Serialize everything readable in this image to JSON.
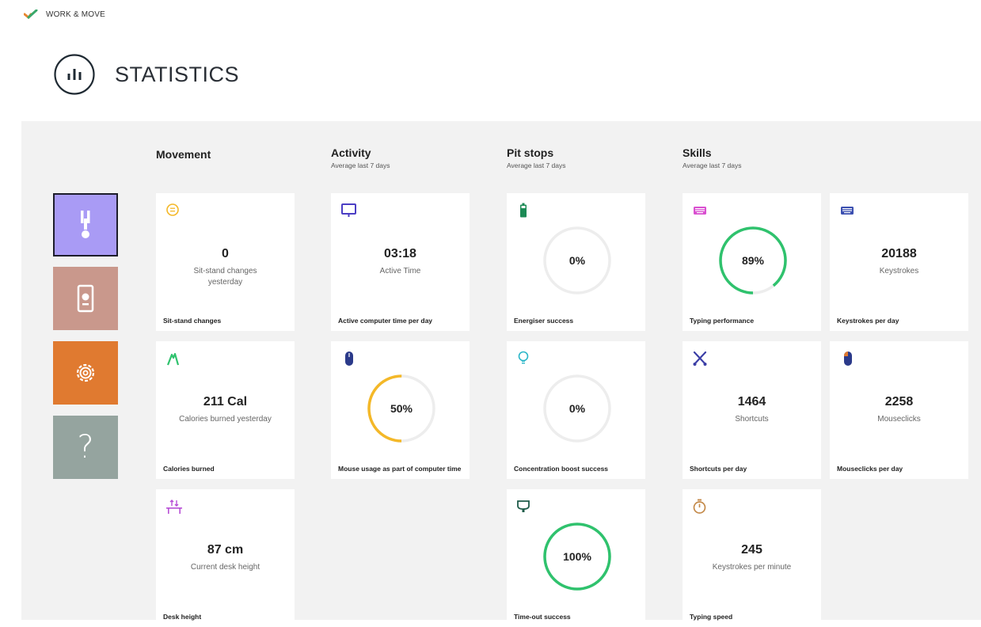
{
  "app": {
    "brand": "WORK & MOVE",
    "page_title": "STATISTICS"
  },
  "sidebar": [
    {
      "id": "movement",
      "icon": "posture-icon",
      "color": "#a99bf5",
      "active": true
    },
    {
      "id": "device",
      "icon": "device-icon",
      "color": "#c9988c",
      "active": false
    },
    {
      "id": "settings",
      "icon": "gear-icon",
      "color": "#e07a30",
      "active": false
    },
    {
      "id": "help",
      "icon": "question-icon",
      "label": "?",
      "color": "#95a49f",
      "active": false
    }
  ],
  "sections": {
    "movement": {
      "title": "Movement"
    },
    "activity": {
      "title": "Activity",
      "subtitle": "Average last 7 days"
    },
    "pitstops": {
      "title": "Pit stops",
      "subtitle": "Average last 7 days"
    },
    "skills": {
      "title": "Skills",
      "subtitle": "Average last 7 days"
    }
  },
  "cards": {
    "sit_stand": {
      "icon": "smiley-icon",
      "value": "0",
      "desc": "Sit-stand changes yesterday",
      "label": "Sit-stand changes"
    },
    "calories": {
      "icon": "flame-icon",
      "value": "211 Cal",
      "desc": "Calories burned yesterday",
      "label": "Calories burned"
    },
    "desk_height": {
      "icon": "desk-height-icon",
      "value": "87 cm",
      "desc": "Current desk height",
      "label": "Desk height"
    },
    "active_time": {
      "icon": "monitor-icon",
      "value": "03:18",
      "desc": "Active Time",
      "label": "Active computer time per day"
    },
    "mouse_usage": {
      "icon": "mouse-icon",
      "percent": "50%",
      "fraction": 0.5,
      "color": "#f4b828",
      "label": "Mouse usage as part of computer time"
    },
    "energiser": {
      "icon": "battery-icon",
      "percent": "0%",
      "fraction": 0,
      "color": "#2fc26d",
      "label": "Energiser success"
    },
    "concentration": {
      "icon": "lightbulb-icon",
      "percent": "0%",
      "fraction": 0,
      "color": "#2fc26d",
      "label": "Concentration boost success"
    },
    "timeout": {
      "icon": "cup-icon",
      "percent": "100%",
      "fraction": 1,
      "color": "#2fc26d",
      "label": "Time-out success"
    },
    "typing_perf": {
      "icon": "keyboard-icon",
      "percent": "89%",
      "fraction": 0.89,
      "color": "#2fc26d",
      "label": "Typing performance"
    },
    "keystrokes": {
      "icon": "keyboard-icon",
      "value": "20188",
      "desc": "Keystrokes",
      "label": "Keystrokes per day"
    },
    "shortcuts": {
      "icon": "scissors-icon",
      "value": "1464",
      "desc": "Shortcuts",
      "label": "Shortcuts per day"
    },
    "mouseclicks": {
      "icon": "mouse-icon",
      "value": "2258",
      "desc": "Mouseclicks",
      "label": "Mouseclicks per day"
    },
    "typing_speed": {
      "icon": "stopwatch-icon",
      "value": "245",
      "desc": "Keystrokes per minute",
      "label": "Typing speed"
    }
  }
}
